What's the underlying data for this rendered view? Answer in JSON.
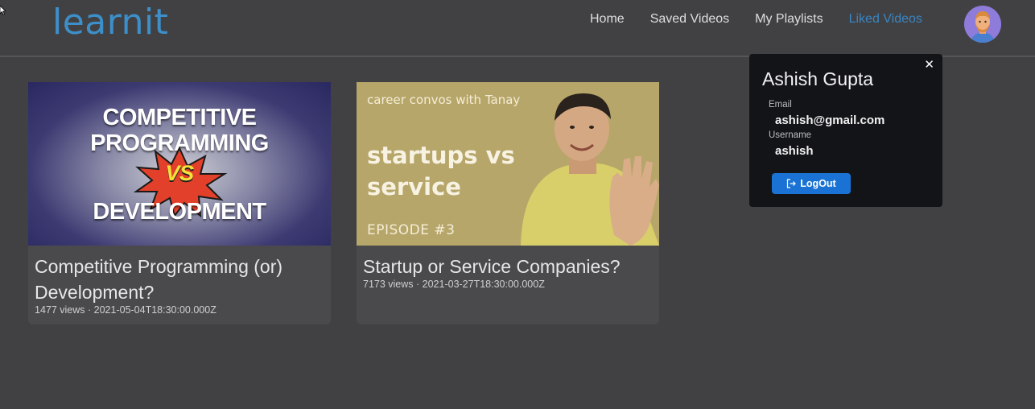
{
  "app": {
    "logo_text": "learnit"
  },
  "nav": {
    "items": [
      {
        "label": "Home"
      },
      {
        "label": "Saved Videos"
      },
      {
        "label": "My Playlists"
      },
      {
        "label": "Liked Videos"
      }
    ],
    "active_color": "#3a85c2"
  },
  "videos": [
    {
      "title": "Competitive Programming (or) Development?",
      "meta": "1477 views · 2021-05-04T18:30:00.000Z",
      "thumbnail": {
        "line1": "COMPETITIVE",
        "line2": "PROGRAMMING",
        "vs": "VS",
        "line3": "DEVELOPMENT"
      }
    },
    {
      "title": "Startup or Service Companies?",
      "meta": "7173 views · 2021-03-27T18:30:00.000Z",
      "thumbnail": {
        "small": "career convos with Tanay",
        "big_line1": "startups vs",
        "big_line2": "service",
        "episode": "EPISODE #3"
      }
    }
  ],
  "profile_popup": {
    "close_icon": "close-icon",
    "name": "Ashish Gupta",
    "email_label": "Email",
    "email": "ashish@gmail.com",
    "username_label": "Username",
    "username": "ashish",
    "logout_label": "LogOut",
    "logout_color": "#1a73d4"
  }
}
